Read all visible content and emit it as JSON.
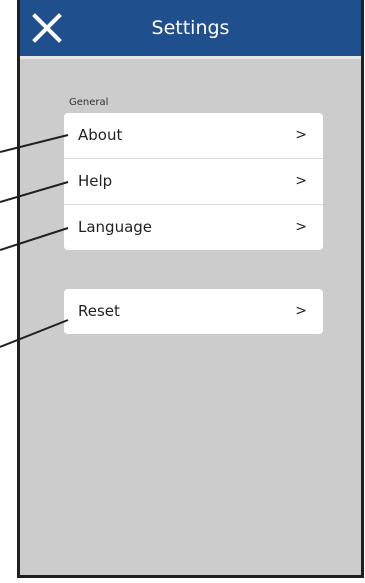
{
  "header": {
    "title": "Settings",
    "close_icon": "close-icon",
    "bar_color": "#1f4f8c"
  },
  "general": {
    "section_label": "General",
    "items": [
      {
        "label": "About",
        "chevron": ">"
      },
      {
        "label": "Help",
        "chevron": ">"
      },
      {
        "label": "Language",
        "chevron": ">"
      }
    ]
  },
  "reset": {
    "items": [
      {
        "label": "Reset",
        "chevron": ">"
      }
    ]
  },
  "colors": {
    "background": "#cccccc",
    "card": "#ffffff",
    "text": "#231f20"
  }
}
